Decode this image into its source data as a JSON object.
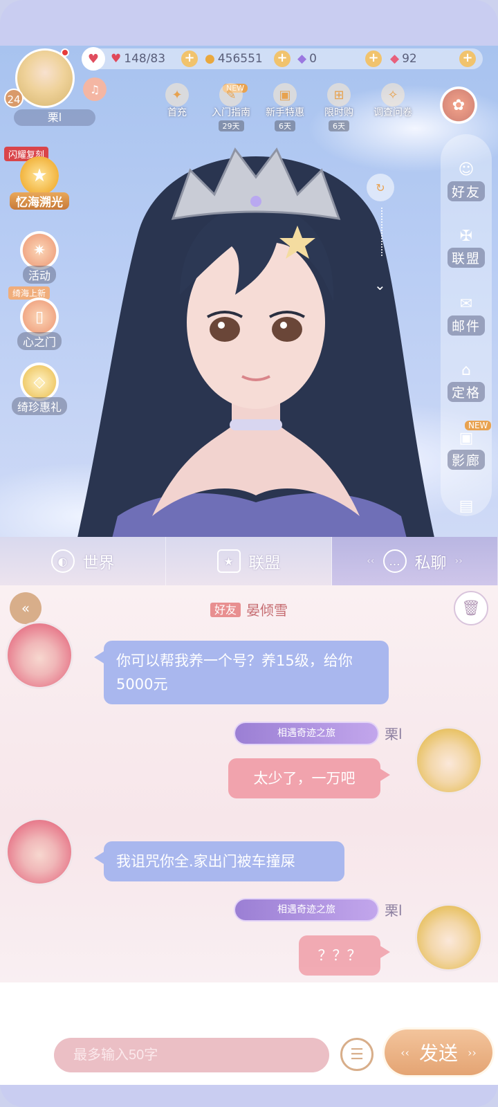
{
  "player": {
    "name": "栗l",
    "level": "24"
  },
  "stats": {
    "stamina": "148/83",
    "gold": "456551",
    "diamonds": "0",
    "crystals": "92"
  },
  "top_menu": [
    {
      "label": "首充",
      "sub": "",
      "icon": "gift-crown-icon"
    },
    {
      "label": "入门指南",
      "sub": "29天",
      "icon": "guide-book-icon",
      "tag": "NEW"
    },
    {
      "label": "新手特惠",
      "sub": "6天",
      "icon": "shopping-bag-icon"
    },
    {
      "label": "限时购",
      "sub": "6天",
      "icon": "present-box-icon"
    },
    {
      "label": "调查问卷",
      "sub": "",
      "icon": "questionnaire-icon"
    }
  ],
  "left_menu": {
    "flash_tag": "闪耀复刻",
    "yihai": "忆海溯光",
    "activity": "活动",
    "update_tag": "绮海上新",
    "heart_gate": "心之门",
    "jewel_offer": "绮珍惠礼"
  },
  "right_menu": [
    {
      "label": "好友",
      "icon": "friend-icon"
    },
    {
      "label": "联盟",
      "icon": "alliance-icon"
    },
    {
      "label": "邮件",
      "icon": "mail-icon"
    },
    {
      "label": "定格",
      "icon": "home-icon"
    },
    {
      "label": "影廊",
      "icon": "camera-icon",
      "tag": "NEW"
    }
  ],
  "tabs": [
    {
      "label": "世界",
      "icon": "globe-icon"
    },
    {
      "label": "联盟",
      "icon": "shield-star-icon"
    },
    {
      "label": "私聊",
      "icon": "chat-bubble-icon",
      "active": true
    }
  ],
  "chat": {
    "friend_tag": "好友",
    "partner_name": "晏倾雪",
    "my_title": "相遇奇迹之旅",
    "my_name": "栗l",
    "messages": [
      {
        "side": "left",
        "text": "你可以帮我养一个号？养15级，给你5000元"
      },
      {
        "side": "right",
        "text": "太少了，一万吧"
      },
      {
        "side": "left",
        "text": "我诅咒你全.家出门被车撞屎"
      },
      {
        "side": "right",
        "text": "？？？"
      }
    ]
  },
  "input": {
    "placeholder": "最多输入50字",
    "send_label": "发送"
  },
  "colors": {
    "left_bubble": "#a9b7ee",
    "right_bubble": "#f1a3ad",
    "send": "#e4a473"
  }
}
